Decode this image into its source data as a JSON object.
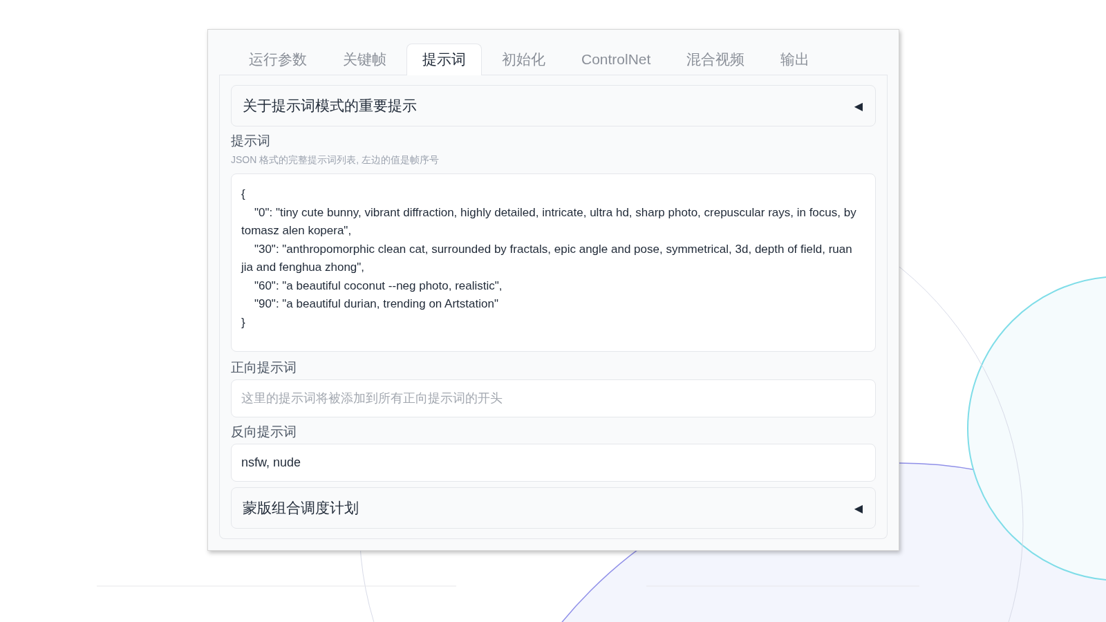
{
  "tabs": [
    {
      "label": "运行参数",
      "selected": false
    },
    {
      "label": "关键帧",
      "selected": false
    },
    {
      "label": "提示词",
      "selected": true
    },
    {
      "label": "初始化",
      "selected": false
    },
    {
      "label": "ControlNet",
      "selected": false
    },
    {
      "label": "混合视频",
      "selected": false
    },
    {
      "label": "输出",
      "selected": false
    }
  ],
  "notice_accordion": {
    "title": "关于提示词模式的重要提示",
    "icon": "◀",
    "expanded": false
  },
  "prompts": {
    "label": "提示词",
    "hint": "JSON 格式的完整提示词列表, 左边的值是帧序号",
    "value": "{\n    \"0\": \"tiny cute bunny, vibrant diffraction, highly detailed, intricate, ultra hd, sharp photo, crepuscular rays, in focus, by tomasz alen kopera\",\n    \"30\": \"anthropomorphic clean cat, surrounded by fractals, epic angle and pose, symmetrical, 3d, depth of field, ruan jia and fenghua zhong\",\n    \"60\": \"a beautiful coconut --neg photo, realistic\",\n    \"90\": \"a beautiful durian, trending on Artstation\"\n}"
  },
  "positive_prompt": {
    "label": "正向提示词",
    "placeholder": "这里的提示词将被添加到所有正向提示词的开头"
  },
  "negative_prompt": {
    "label": "反向提示词",
    "value": "nsfw, nude"
  },
  "schedule_accordion": {
    "title": "蒙版组合调度计划",
    "icon": "◀",
    "expanded": false
  }
}
